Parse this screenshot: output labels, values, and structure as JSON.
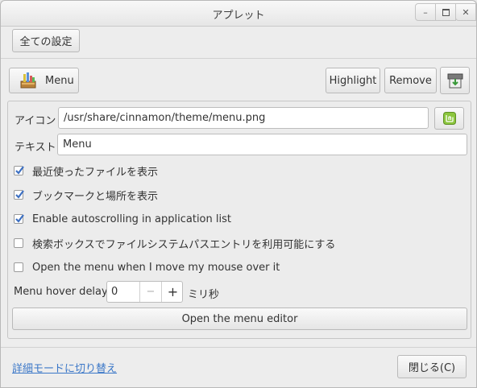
{
  "window": {
    "title": "アプレット"
  },
  "toolbar": {
    "all_settings": "全ての設定"
  },
  "applet": {
    "name": "Menu",
    "highlight": "Highlight",
    "remove": "Remove"
  },
  "settings": {
    "icon_label": "アイコン",
    "icon_value": "/usr/share/cinnamon/theme/menu.png",
    "text_label": "テキスト",
    "text_value": "Menu",
    "checks": [
      {
        "label": "最近使ったファイルを表示",
        "checked": true
      },
      {
        "label": "ブックマークと場所を表示",
        "checked": true
      },
      {
        "label": "Enable autoscrolling in application list",
        "checked": true
      },
      {
        "label": "検索ボックスでファイルシステムパスエントリを利用可能にする",
        "checked": false
      },
      {
        "label": "Open the menu when I move my mouse over it",
        "checked": false
      }
    ],
    "hover_label": "Menu hover delay:",
    "hover_value": "0",
    "hover_unit": "ミリ秒",
    "editor_button": "Open the menu editor"
  },
  "footer": {
    "advanced_link": "詳細モードに切り替え",
    "close_button": "閉じる(C)"
  },
  "colors": {
    "accent": "#3c78c8",
    "mint": "#8cc63e"
  }
}
